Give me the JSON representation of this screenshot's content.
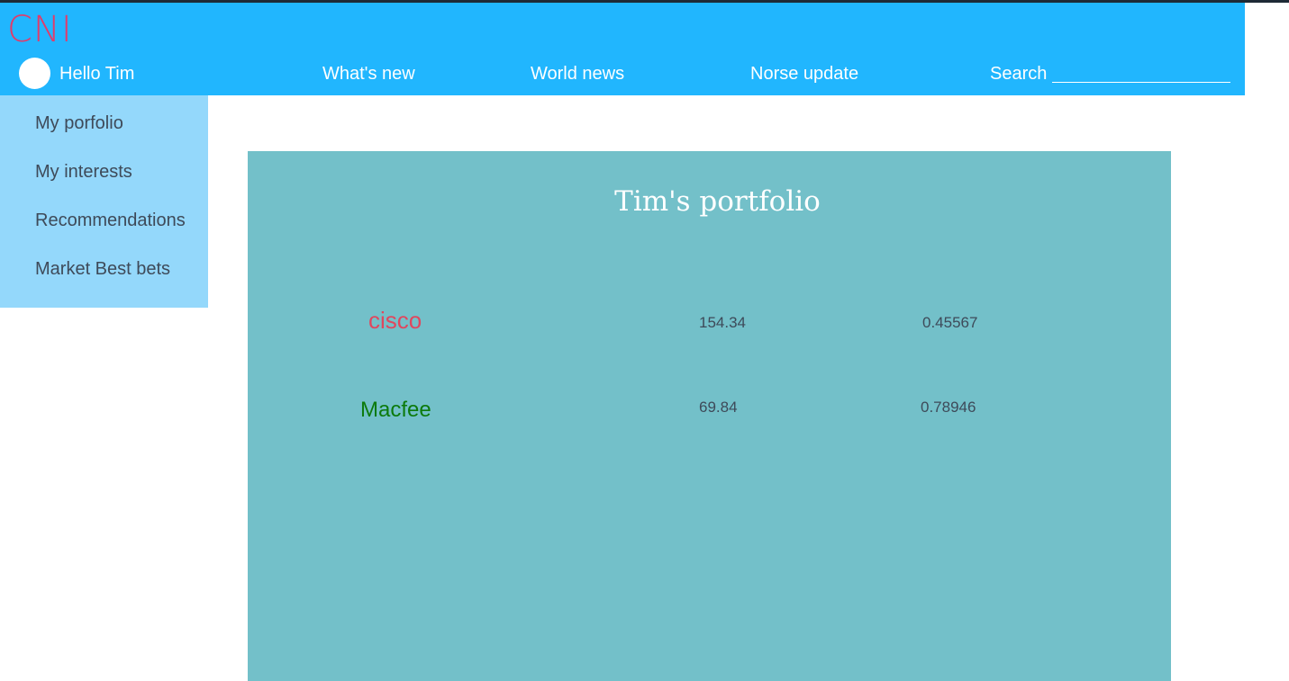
{
  "header": {
    "logo": "CNI",
    "greeting": "Hello Tim",
    "nav": [
      "What's new",
      "World news",
      "Norse update"
    ],
    "search_label": "Search",
    "search_value": ""
  },
  "sidebar": {
    "items": [
      "My porfolio",
      "My interests",
      "Recommendations",
      "Market Best bets"
    ]
  },
  "portfolio": {
    "title": "Tim's portfolio",
    "rows": [
      {
        "name": "cisco",
        "name_color": "#e0475e",
        "value": "154.34",
        "ratio": "0.45567"
      },
      {
        "name": "Macfee",
        "name_color": "#0c7a0c",
        "value": "69.84",
        "ratio": "0.78946"
      }
    ]
  },
  "colors": {
    "header_bg": "#21b6fe",
    "sidebar_bg": "#94d8fb",
    "panel_bg": "#73c0c9",
    "logo": "#e23b6a"
  }
}
